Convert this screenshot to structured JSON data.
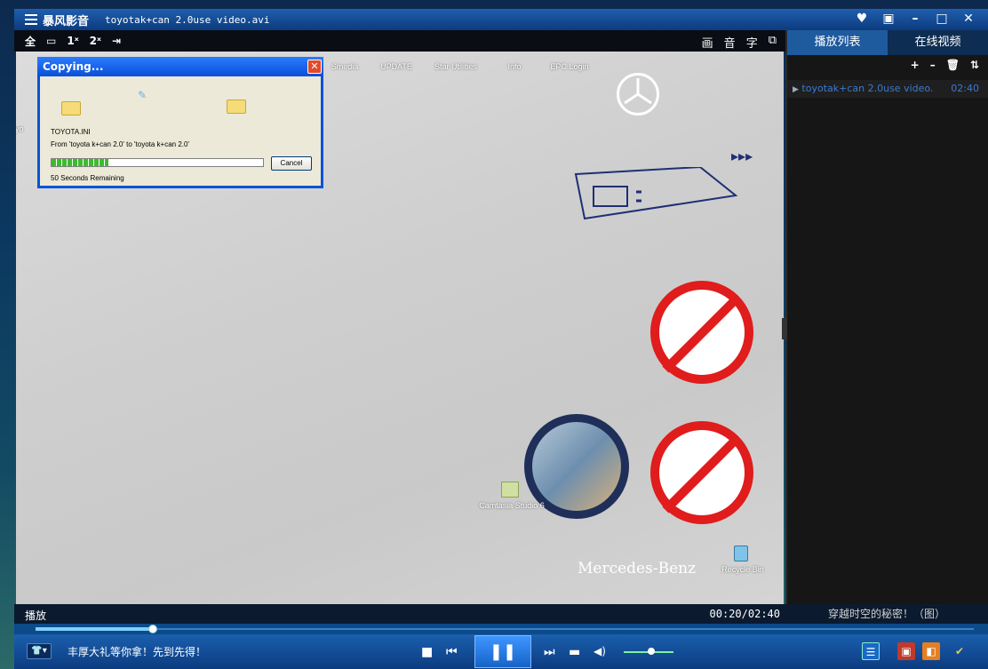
{
  "app": {
    "name": "暴风影音",
    "file": "toyotak+can 2.0use video.avi",
    "window_buttons": [
      "♥",
      "▣",
      "–",
      "□",
      "✕"
    ]
  },
  "toolbar": {
    "left": [
      "全",
      "▭",
      "1ˣ",
      "2ˣ",
      "⇥"
    ],
    "right": [
      "画",
      "音",
      "字",
      "⧉"
    ]
  },
  "desktop": {
    "icon_labels": [
      "Smedia",
      "UPDATE",
      "Star Utilities",
      "Info",
      "EPC Login"
    ],
    "left_label": "toyo",
    "camtasia": "Camtasia Studio 6",
    "recycle": "Recycle Bin",
    "brand": "Mercedes-Benz"
  },
  "dialog": {
    "title": "Copying...",
    "file": "TOYOTA.INI",
    "from_to": "From 'toyota k+can 2.0' to 'toyota k+can 2.0'",
    "remaining": "50 Seconds Remaining",
    "cancel": "Cancel",
    "progress": 0.27
  },
  "right_panel": {
    "tabs": [
      "播放列表",
      "在线视频"
    ],
    "tools": [
      "+",
      "–",
      "🗑",
      "⇅"
    ],
    "items": [
      {
        "title": "toyotak+can 2.0use video.",
        "duration": "02:40"
      }
    ],
    "promo": "穿越时空的秘密！（图）"
  },
  "status": {
    "state": "播放",
    "time": "00:20/02:40"
  },
  "seek": {
    "progress": 0.125
  },
  "volume": {
    "level": 0.55
  },
  "bottom": {
    "promo": "丰厚大礼等你拿！先到先得！",
    "skin": "👕▾"
  }
}
